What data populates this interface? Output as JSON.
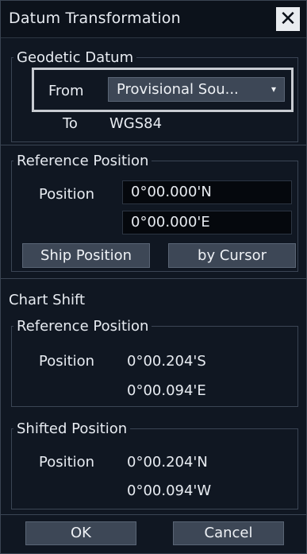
{
  "window": {
    "title": "Datum Transformation"
  },
  "geodetic": {
    "legend": "Geodetic Datum",
    "from_label": "From",
    "from_value": "Provisional Sou...",
    "to_label": "To",
    "to_value": "WGS84"
  },
  "reference": {
    "legend": "Reference Position",
    "position_label": "Position",
    "lat": "0°00.000'N",
    "lon": "0°00.000'E",
    "ship_button": "Ship Position",
    "cursor_button": "by Cursor"
  },
  "chart_shift": {
    "title": "Chart Shift",
    "ref_legend": "Reference Position",
    "ref_position_label": "Position",
    "ref_lat": "0°00.204'S",
    "ref_lon": "0°00.094'E",
    "shifted_legend": "Shifted Position",
    "shifted_position_label": "Position",
    "shifted_lat": "0°00.204'N",
    "shifted_lon": "0°00.094'W"
  },
  "footer": {
    "ok": "OK",
    "cancel": "Cancel"
  },
  "icons": {
    "close": "close-icon",
    "dropdown": "chevron-down-icon"
  }
}
